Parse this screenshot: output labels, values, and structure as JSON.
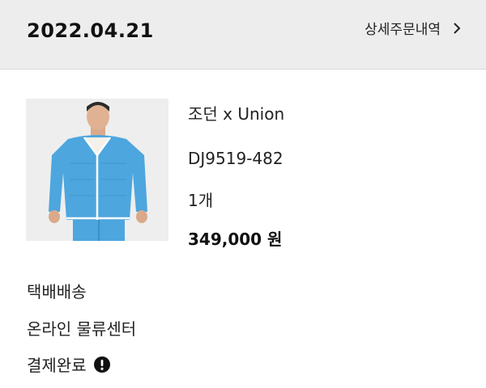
{
  "order": {
    "date": "2022.04.21",
    "detail_link_label": "상세주문내역"
  },
  "icons": {
    "chevron": "chevron-right-icon",
    "alert": "exclamation-circle-icon"
  },
  "product": {
    "name": "조던 x Union",
    "code": "DJ9519-482",
    "quantity": "1개",
    "price": "349,000 원",
    "colors": {
      "jacket": "#4da6de",
      "background": "#eeeeee"
    }
  },
  "shipping": {
    "method": "택배배송",
    "warehouse": "온라인 물류센터"
  },
  "payment": {
    "status": "결제완료"
  }
}
